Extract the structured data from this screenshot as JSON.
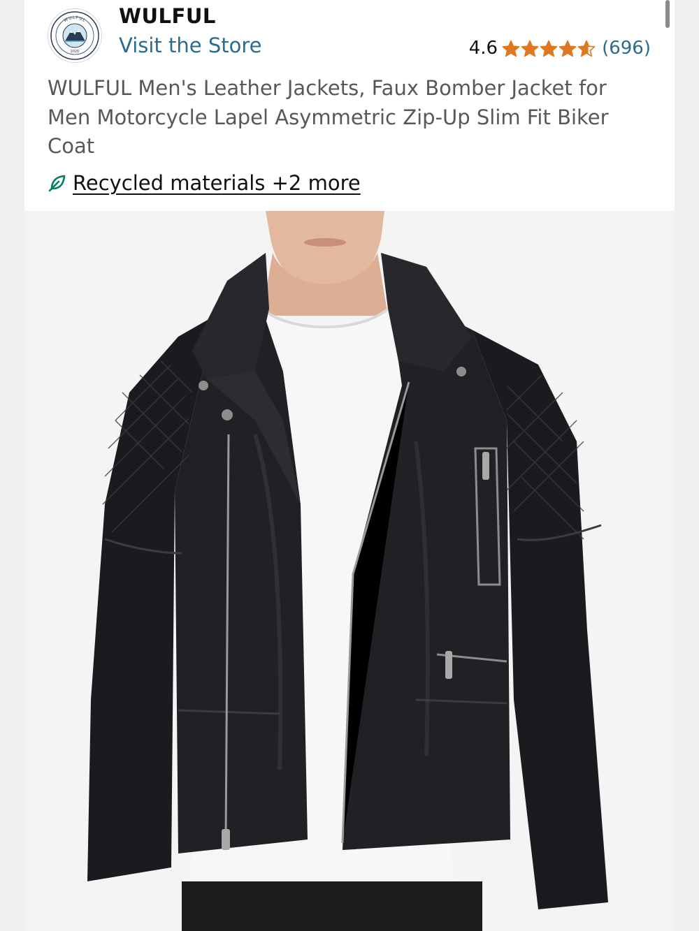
{
  "header": {
    "brand_name": "WULFUL",
    "visit_store_label": "Visit the Store",
    "logo_text": "WULFUL",
    "logo_year": "2020"
  },
  "rating": {
    "value": "4.6",
    "stars_filled": 4.6,
    "max_stars": 5,
    "count_label": "(696)",
    "star_color": "#de7921"
  },
  "product": {
    "title": "WULFUL Men's Leather Jackets, Faux Bomber Jacket for Men Motorcycle Lapel Asymmetric Zip-Up Slim Fit Biker Coat",
    "sustainability_label": "Recycled materials +2 more",
    "image_icon": "product-photo-black-leather-jacket"
  },
  "colors": {
    "link": "#2a6c8f",
    "text_primary": "#0f1111",
    "text_secondary": "#565959",
    "leaf": "#067d62"
  }
}
